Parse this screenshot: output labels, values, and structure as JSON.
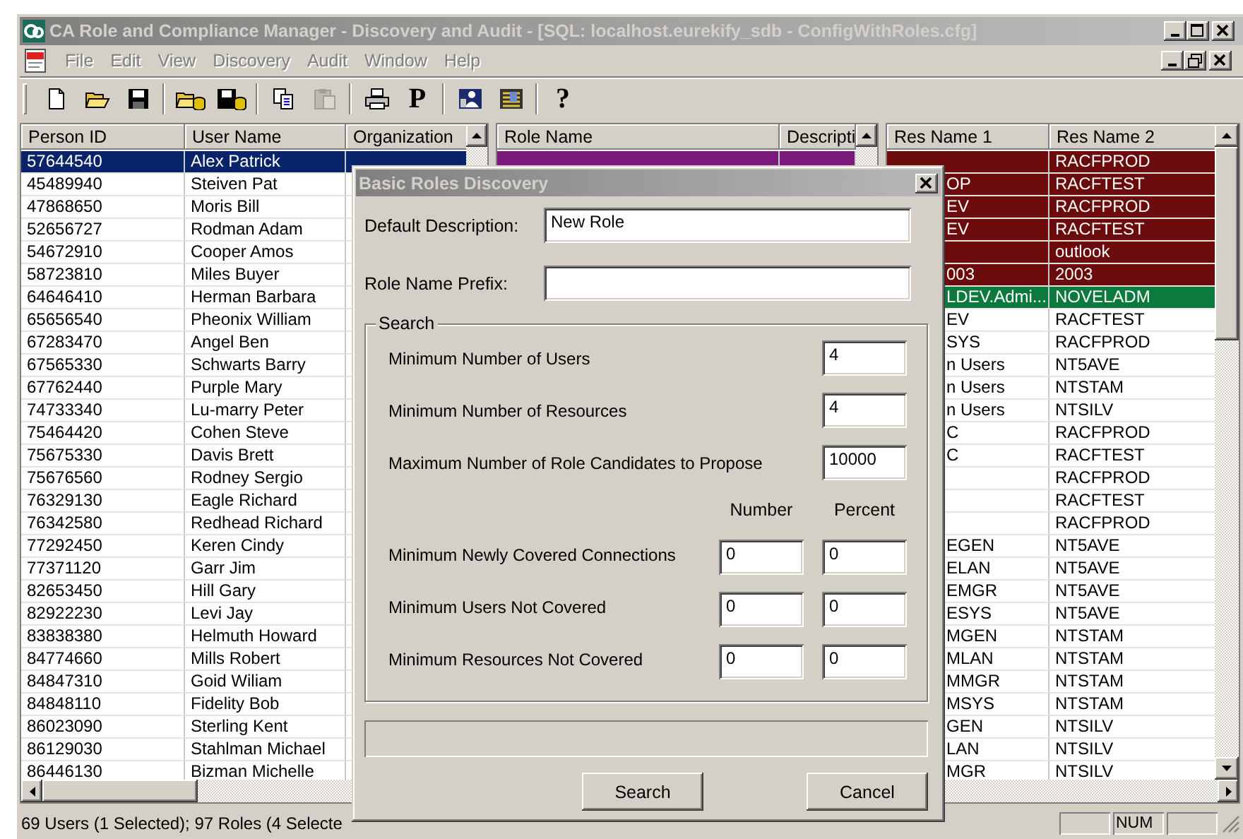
{
  "window": {
    "title": "CA Role and Compliance Manager - Discovery and Audit - [SQL: localhost.eurekify_sdb - ConfigWithRoles.cfg]"
  },
  "menu": [
    {
      "label": "File",
      "disabled": true
    },
    {
      "label": "Edit",
      "disabled": true
    },
    {
      "label": "View",
      "disabled": true
    },
    {
      "label": "Discovery",
      "disabled": true
    },
    {
      "label": "Audit",
      "disabled": true
    },
    {
      "label": "Window",
      "disabled": true
    },
    {
      "label": "Help",
      "disabled": true
    }
  ],
  "toolbar": [
    [
      {
        "kind": "new",
        "disabled": false
      },
      {
        "kind": "open",
        "disabled": false
      },
      {
        "kind": "save",
        "disabled": false
      }
    ],
    [
      {
        "kind": "open-db",
        "disabled": false
      },
      {
        "kind": "save-db",
        "disabled": false
      }
    ],
    [
      {
        "kind": "copy",
        "disabled": false
      },
      {
        "kind": "paste",
        "disabled": true
      }
    ],
    [
      {
        "kind": "print",
        "disabled": false
      },
      {
        "kind": "glyph",
        "label": "P",
        "disabled": false
      }
    ],
    [
      {
        "kind": "users",
        "disabled": false
      },
      {
        "kind": "roles",
        "disabled": false
      }
    ],
    [
      {
        "kind": "glyph",
        "label": "?",
        "disabled": false
      }
    ]
  ],
  "users_grid": {
    "columns": [
      "Person ID",
      "User Name",
      "Organization"
    ],
    "rows": [
      {
        "person_id": "57644540",
        "user_name": "Alex Patrick",
        "selected": true
      },
      {
        "person_id": "45489940",
        "user_name": "Steiven Pat",
        "selected": false
      },
      {
        "person_id": "47868650",
        "user_name": "Moris Bill",
        "selected": false
      },
      {
        "person_id": "52656727",
        "user_name": "Rodman Adam",
        "selected": false
      },
      {
        "person_id": "54672910",
        "user_name": "Cooper Amos",
        "selected": false
      },
      {
        "person_id": "58723810",
        "user_name": "Miles Buyer",
        "selected": false
      },
      {
        "person_id": "64646410",
        "user_name": "Herman Barbara",
        "selected": false
      },
      {
        "person_id": "65656540",
        "user_name": "Pheonix William",
        "selected": false
      },
      {
        "person_id": "67283470",
        "user_name": "Angel Ben",
        "selected": false
      },
      {
        "person_id": "67565330",
        "user_name": "Schwarts Barry",
        "selected": false
      },
      {
        "person_id": "67762440",
        "user_name": "Purple Mary",
        "selected": false
      },
      {
        "person_id": "74733340",
        "user_name": "Lu-marry Peter",
        "selected": false
      },
      {
        "person_id": "75464420",
        "user_name": "Cohen Steve",
        "selected": false
      },
      {
        "person_id": "75675330",
        "user_name": "Davis Brett",
        "selected": false
      },
      {
        "person_id": "75676560",
        "user_name": "Rodney Sergio",
        "selected": false
      },
      {
        "person_id": "76329130",
        "user_name": "Eagle Richard",
        "selected": false
      },
      {
        "person_id": "76342580",
        "user_name": "Redhead Richard",
        "selected": false
      },
      {
        "person_id": "77292450",
        "user_name": "Keren Cindy",
        "selected": false
      },
      {
        "person_id": "77371120",
        "user_name": "Garr Jim",
        "selected": false
      },
      {
        "person_id": "82653450",
        "user_name": "Hill Gary",
        "selected": false
      },
      {
        "person_id": "82922230",
        "user_name": "Levi Jay",
        "selected": false
      },
      {
        "person_id": "83838380",
        "user_name": "Helmuth Howard",
        "selected": false
      },
      {
        "person_id": "84774660",
        "user_name": "Mills Robert",
        "selected": false
      },
      {
        "person_id": "84847310",
        "user_name": "Goid Wiliam",
        "selected": false
      },
      {
        "person_id": "84848110",
        "user_name": "Fidelity Bob",
        "selected": false
      },
      {
        "person_id": "86023090",
        "user_name": "Sterling Kent",
        "selected": false
      },
      {
        "person_id": "86129030",
        "user_name": "Stahlman Michael",
        "selected": false
      },
      {
        "person_id": "86446130",
        "user_name": "Bizman Michelle",
        "selected": false
      }
    ]
  },
  "roles_grid": {
    "columns": [
      "Role Name",
      "Descripti"
    ],
    "rows": [
      {
        "selected": true
      }
    ]
  },
  "resources_grid": {
    "columns": [
      "Res Name 1",
      "Res Name 2"
    ],
    "rows": [
      {
        "res_name_2": "RACFPROD",
        "selected": true,
        "color": "#6b0b0b"
      },
      {
        "res_name_1": "OP",
        "res_name_2": "RACFTEST",
        "selected": true,
        "color": "#6b0b0b"
      },
      {
        "res_name_1": "EV",
        "res_name_2": "RACFPROD",
        "selected": true,
        "color": "#6b0b0b"
      },
      {
        "res_name_1": "EV",
        "res_name_2": "RACFTEST",
        "selected": true,
        "color": "#6b0b0b"
      },
      {
        "res_name_2": "outlook",
        "selected": true,
        "color": "#6b0b0b"
      },
      {
        "res_name_1": "003",
        "res_name_2": "2003",
        "selected": true,
        "color": "#6b0b0b"
      },
      {
        "res_name_1": "LDEV.Admi...",
        "res_name_2": "NOVELADM",
        "selected": true,
        "color": "#0b7a3c"
      },
      {
        "res_name_1": "EV",
        "res_name_2": "RACFTEST",
        "selected": false
      },
      {
        "res_name_1": "SYS",
        "res_name_2": "RACFPROD",
        "selected": false
      },
      {
        "res_name_1": "n Users",
        "res_name_2": "NT5AVE",
        "selected": false
      },
      {
        "res_name_1": "n Users",
        "res_name_2": "NTSTAM",
        "selected": false
      },
      {
        "res_name_1": "n Users",
        "res_name_2": "NTSILV",
        "selected": false
      },
      {
        "res_name_1": "C",
        "res_name_2": "RACFPROD",
        "selected": false
      },
      {
        "res_name_1": "C",
        "res_name_2": "RACFTEST",
        "selected": false
      },
      {
        "res_name_2": "RACFPROD",
        "selected": false
      },
      {
        "res_name_2": "RACFTEST",
        "selected": false
      },
      {
        "res_name_2": "RACFPROD",
        "selected": false
      },
      {
        "res_name_1": "EGEN",
        "res_name_2": "NT5AVE",
        "selected": false
      },
      {
        "res_name_1": "ELAN",
        "res_name_2": "NT5AVE",
        "selected": false
      },
      {
        "res_name_1": "EMGR",
        "res_name_2": "NT5AVE",
        "selected": false
      },
      {
        "res_name_1": "ESYS",
        "res_name_2": "NT5AVE",
        "selected": false
      },
      {
        "res_name_1": "MGEN",
        "res_name_2": "NTSTAM",
        "selected": false
      },
      {
        "res_name_1": "MLAN",
        "res_name_2": "NTSTAM",
        "selected": false
      },
      {
        "res_name_1": "MMGR",
        "res_name_2": "NTSTAM",
        "selected": false
      },
      {
        "res_name_1": "MSYS",
        "res_name_2": "NTSTAM",
        "selected": false
      },
      {
        "res_name_1": "GEN",
        "res_name_2": "NTSILV",
        "selected": false
      },
      {
        "res_name_1": "LAN",
        "res_name_2": "NTSILV",
        "selected": false
      },
      {
        "res_name_1": "MGR",
        "res_name_2": "NTSILV",
        "selected": false
      }
    ]
  },
  "dialog": {
    "title": "Basic Roles Discovery",
    "fields": [
      {
        "label": "Default Description:",
        "value": "New Role"
      },
      {
        "label": "Role Name Prefix:"
      }
    ],
    "search_group": {
      "title": "Search",
      "settings": [
        {
          "label": "Minimum Number of Users",
          "value": "4"
        },
        {
          "label": "Minimum Number of Resources",
          "value": "4"
        },
        {
          "label": "Maximum Number of Role Candidates to Propose",
          "value": "10000"
        }
      ],
      "column_headers": [
        "Number",
        "Percent"
      ],
      "thresholds": [
        {
          "label": "Minimum Newly Covered Connections",
          "number": "0",
          "percent": "0"
        },
        {
          "label": "Minimum Users Not Covered",
          "number": "0",
          "percent": "0"
        },
        {
          "label": "Minimum Resources Not Covered",
          "number": "0",
          "percent": "0"
        }
      ]
    },
    "buttons": [
      "Search",
      "Cancel"
    ]
  },
  "status_bar": {
    "text": "69 Users (1 Selected); 97 Roles (4 Selecte",
    "indicators": [
      "NUM"
    ]
  }
}
